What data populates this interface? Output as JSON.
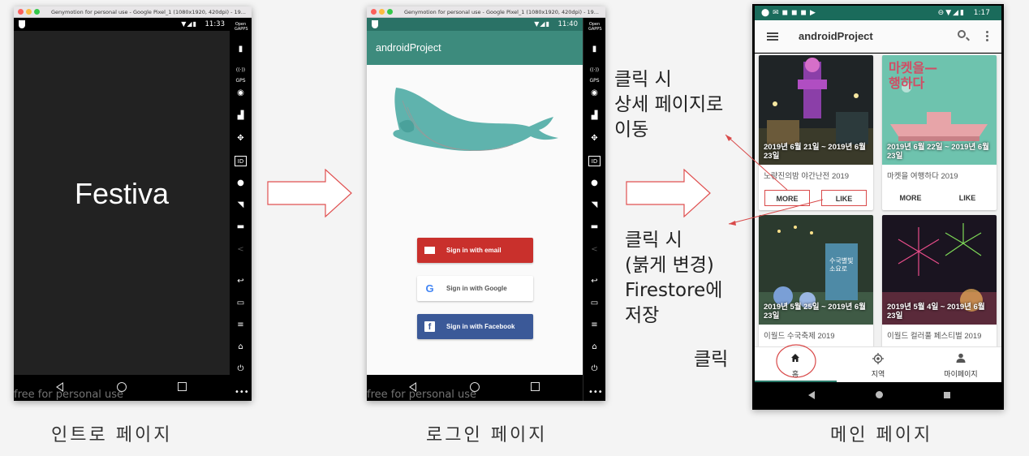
{
  "emulator": {
    "title": "Genymotion for personal use - Google Pixel_1 (1080x1920, 420dpi) - 19...",
    "watermark": "free for personal use",
    "toolbar_open_label": "Open\nGAPPS",
    "toolbar_gps_label": "GPS"
  },
  "intro": {
    "time": "11:33",
    "logo_text": "Festiva",
    "caption": "인트로 페이지"
  },
  "login": {
    "time": "11:40",
    "app_title": "androidProject",
    "buttons": {
      "email": "Sign in with email",
      "google": "Sign in with Google",
      "facebook": "Sign in with Facebook"
    },
    "caption": "로그인 페이지"
  },
  "main": {
    "time": "1:17",
    "app_title": "androidProject",
    "cards": [
      {
        "date": "2019년 6월 21일 ~ 2019년 6월 23일",
        "title": "노량진의밤 야간난전 2019",
        "more": "MORE",
        "like": "LIKE"
      },
      {
        "date": "2019년 6월 22일 ~ 2019년 6월 23일",
        "title": "마켓을 여행하다 2019",
        "more": "MORE",
        "like": "LIKE",
        "poster_text": "마켓을—\n행하다"
      },
      {
        "date": "2019년 5월 25일 ~ 2019년 6월 23일",
        "title": "이월드 수국축제 2019",
        "poster_text": "수국별빛\n소요로"
      },
      {
        "date": "2019년 5월 4일 ~ 2019년 6월 23일",
        "title": "이월드 컬러풀 페스티벌 2019"
      }
    ],
    "bottom_nav": {
      "home": "홈",
      "area": "지역",
      "mypage": "마이페이지"
    },
    "caption": "메인 페이지"
  },
  "notes": {
    "more": "클릭 시\n상세 페이지로\n이동",
    "like": "클릭 시\n(붉게 변경)\nFirestore에\n저장",
    "home": "클릭"
  },
  "colors": {
    "app_teal": "#3d8b7d",
    "status_teal": "#1a6b5b",
    "email_red": "#c9302c",
    "facebook_blue": "#3b5998",
    "highlight_red": "#d94a4a"
  }
}
